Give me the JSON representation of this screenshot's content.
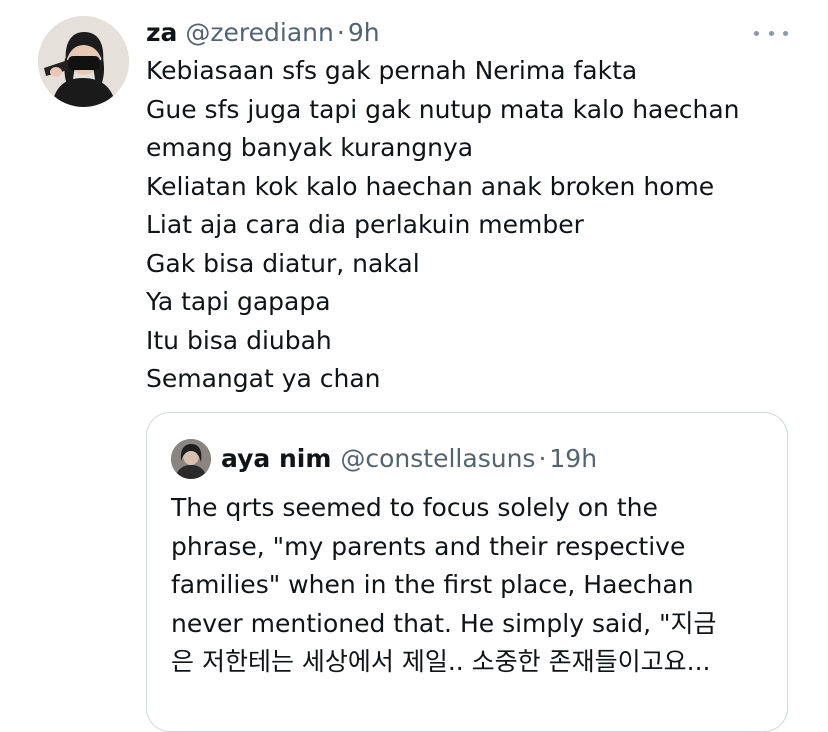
{
  "tweet": {
    "display_name": "za",
    "handle": "@zerediann",
    "separator": "·",
    "time": "9h",
    "text_lines": [
      "Kebiasaan sfs gak pernah Nerima fakta",
      "Gue sfs juga tapi gak nutup mata kalo haechan",
      "emang banyak kurangnya",
      "Keliatan kok kalo haechan anak broken home",
      "Liat aja cara dia perlakuin member",
      "Gak bisa diatur, nakal",
      "Ya tapi gapapa",
      "Itu bisa diubah",
      "Semangat ya chan"
    ]
  },
  "quote": {
    "display_name": "aya nim",
    "handle": "@constellasuns",
    "separator": "·",
    "time": "19h",
    "text_lines": [
      "The qrts seemed to focus solely on the",
      "phrase, \"my parents and their respective",
      "families\" when in the first place, Haechan",
      "never mentioned that. He simply said, \"지금",
      "은 저한테는 세상에서 제일.. 소중한 존재들이고요..."
    ]
  },
  "colors": {
    "text_primary": "#0f1419",
    "text_secondary": "#536471",
    "border": "#cfd9de",
    "more_icon": "#8b98a5"
  },
  "icons": {
    "more": "more-horizontal-icon"
  }
}
